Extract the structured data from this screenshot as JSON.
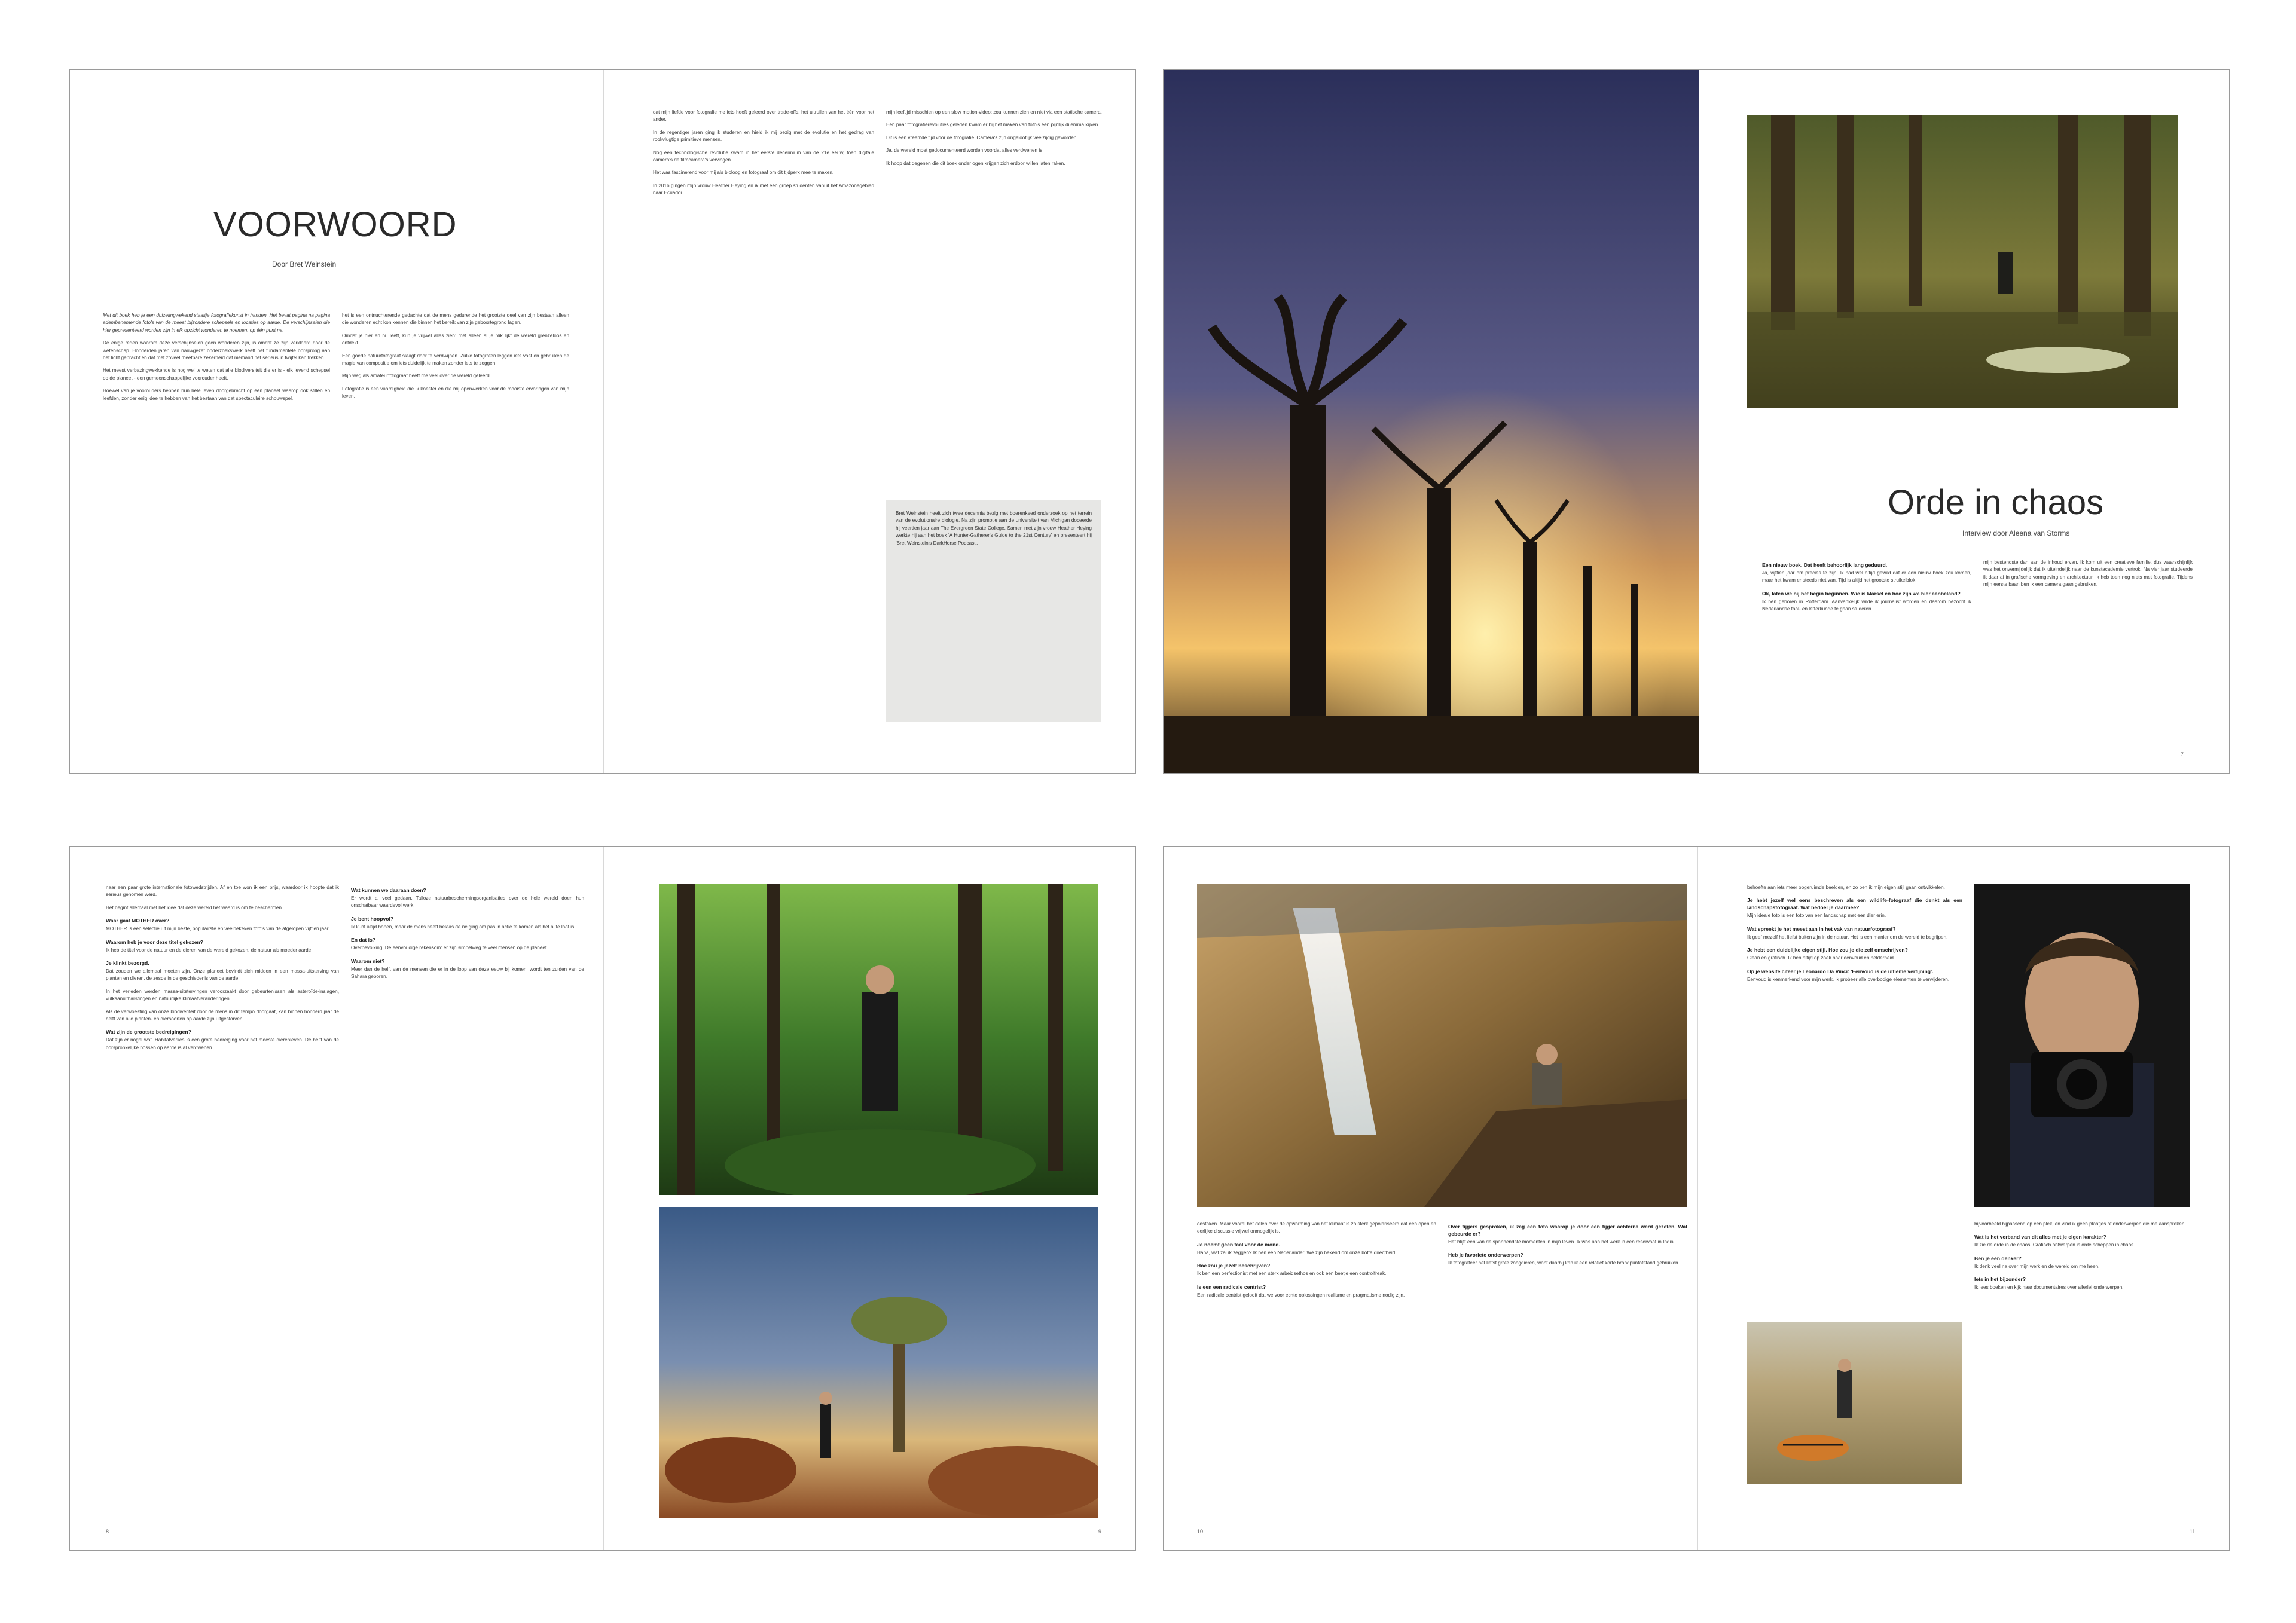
{
  "spread1": {
    "title": "VOORWOORD",
    "byline": "Door Bret Weinstein",
    "lead": "Met dit boek heb je een duizelingwekend staaltje fotografiekunst in handen. Het bevat pagina na pagina adembenemende foto's van de meest bijzondere schepsels en locaties op aarde. De verschijnselen die hier gepresenteerd worden zijn in elk opzicht wonderen te noemen, op één punt na.",
    "col1": [
      "De enige reden waarom deze verschijnselen geen wonderen zijn, is omdat ze zijn verklaard door de wetenschap. Honderden jaren van nauwgezet onderzoekswerk heeft het fundamentele oorsprong aan het licht gebracht en dat met zoveel meetbare zekerheid dat niemand het serieus in twijfel kan trekken.",
      "Het meest verbazingwekkende is nog wel te weten dat alle biodiversiteit die er is - elk levend schepsel op de planeet - een gemeenschappelijke voorouder heeft.",
      "Hoewel van je voorouders hebben hun hele leven doorgebracht op een planeet waarop ook stillen en leefden, zonder enig idee te hebben van het bestaan van dat spectaculaire schouwspel."
    ],
    "col2": [
      "het is een ontnuchterende gedachte dat de mens gedurende het grootste deel van zijn bestaan alleen die wonderen echt kon kennen die binnen het bereik van zijn geboortegrond lagen.",
      "Omdat je hier en nu leeft, kun je vrijwel alles zien: met alleen al je blik lijkt de wereld grenzeloos en ontdekt.",
      "Een goede natuurfotograaf slaagt door te verdwijnen. Zulke fotografen leggen iets vast en gebruiken de magie van compositie om iets duidelijk te maken zonder iets te zeggen.",
      "Mijn weg als amateurfotograaf heeft me veel over de wereld geleerd.",
      "Fotografie is een vaardigheid die ik koester en die mij openwerken voor de mooiste ervaringen van mijn leven."
    ],
    "col3": [
      "dat mijn liefde voor fotografie me iets heeft geleerd over trade-offs, het uitruilen van het één voor het ander.",
      "In de regentiger jaren ging ik studeren en hield ik mij bezig met de evolutie en het gedrag van rookvlugtige primitieve mensen.",
      "Nog een technologische revolutie kwam in het eerste decennium van de 21e eeuw, toen digitale camera's de filmcamera's vervingen.",
      "Het was fascinerend voor mij als bioloog en fotograaf om dit tijdperk mee te maken.",
      "In 2016 gingen mijn vrouw Heather Heying en ik met een groep studenten vanuit het Amazonegebied naar Ecuador."
    ],
    "col4": [
      "mijn leeftijd misschien op een slow motion-video: zou kunnen zien en niet via een statische camera.",
      "Een paar fotografierevoluties geleden kwam er bij het maken van foto's een pijnlijk dilemma kijken.",
      "Dit is een vreemde tijd voor de fotografie. Camera's zijn ongelooflijk veelzijdig geworden.",
      "Ja, de wereld moet gedocumenteerd worden voordat alles verdwenen is.",
      "Ik hoop dat degenen die dit boek onder ogen krijgen zich erdoor willen laten raken."
    ],
    "sidebar": "Bret Weinstein heeft zich twee decennia bezig met boerenkeed onderzoek op het terrein van de evolutionaire biologie. Na zijn promotie aan de universiteit van Michigan doceerde hij veertien jaar aan The Evergreen State College. Samen met zijn vrouw Heather Heying werkte hij aan het boek 'A Hunter-Gatherer's Guide to the 21st Century' en presenteert hij 'Bret Weinstein's DarkHorse Podcast'."
  },
  "spread2": {
    "title": "Orde in chaos",
    "byline": "Interview door Aleena van Storms",
    "q1": "Een nieuw boek. Dat heeft behoorlijk lang geduurd.",
    "a1": "Ja, vijftien jaar om precies te zijn. Ik had wel altijd gewild dat er een nieuw boek zou komen, maar het kwam er steeds niet van. Tijd is altijd het grootste struikelblok.",
    "q2": "Ok, laten we bij het begin beginnen. Wie is Marsel en hoe zijn we hier aanbeland?",
    "a2": "Ik ben geboren in Rotterdam. Aanvankelijk wilde ik journalist worden en daarom bezocht ik Nederlandse taal- en letterkunde te gaan studeren.",
    "col2": "mijn bestendste dan aan de inhoud ervan. Ik kom uit een creatieve familie, dus waarschijnlijk was het onvermijdelijk dat ik uiteindelijk naar de kunstacademie vertrok. Na vier jaar studeerde ik daar af in grafische vormgeving en architectuur. Ik heb toen nog niets met fotografie. Tijdens mijn eerste baan ben ik een camera gaan gebruiken.",
    "folio": "7"
  },
  "spread3": {
    "col1": [
      "naar een paar grote internationale fotowedstrijden. Af en toe won ik een prijs, waardoor ik hoopte dat ik serieus genomen werd.",
      "Het begint allemaal met het idee dat deze wereld het waard is om te beschermen."
    ],
    "q1": "Waar gaat MOTHER over?",
    "a1": "MOTHER is een selectie uit mijn beste, populairste en veelbekeken foto's van de afgelopen vijftien jaar.",
    "q2": "Waarom heb je voor deze titel gekozen?",
    "a2": "Ik heb de titel voor de natuur en de dieren van de wereld gekozen, de natuur als moeder aarde.",
    "q3": "Je klinkt bezorgd.",
    "a3": "Dat zouden we allemaal moeten zijn. Onze planeet bevindt zich midden in een massa-uitsterving van planten en dieren, de zesde in de geschiedenis van de aarde.",
    "a3b": "In het verleden werden massa-uitstervingen veroorzaakt door gebeurtenissen als asteroïde-inslagen, vulkaanuitbarstingen en natuurlijke klimaatveranderingen.",
    "a3c": "Als de verwoesting van onze biodiveriteit door de mens in dit tempo doorgaat, kan binnen honderd jaar de helft van alle planten- en diersoorten op aarde zijn uitgestorven.",
    "q4": "Wat zijn de grootste bedreigingen?",
    "a4": "Dat zijn er nogal wat. Habitatverlies is een grote bedreiging voor het meeste dierenleven. De helft van de oorspronkelijke bossen op aarde is al verdwenen.",
    "col2q1": "Wat kunnen we daaraan doen?",
    "col2a1": "Er wordt al veel gedaan. Talloze natuurbeschermingsorganisaties over de hele wereld doen hun onschatbaar waardevol werk.",
    "col2q2": "Je bent hoopvol?",
    "col2a2": "Ik kunt altijd hopen, maar de mens heeft helaas de neiging om pas in actie te komen als het al te laat is.",
    "col2q3": "En dat is?",
    "col2a3": "Overbevolking. De eenvoudige rekensom: er zijn simpelweg te veel mensen op de planeet.",
    "col2q4": "Waarom niet?",
    "col2a4": "Meer dan de helft van de mensen die er in de loop van deze eeuw bij komen, wordt ten zuiden van de Sahara geboren.",
    "folio_left": "8",
    "folio_right": "9"
  },
  "spread4": {
    "col1": "oostaken. Maar vooral het delen over de opwarming van het klimaat is zo sterk gepolariseerd dat een open en eerlijke discussie vrijwel onmogelijk is.",
    "q1": "Je noemt geen taal voor de mond.",
    "a1": "Haha, wat zal ik zeggen? Ik ben een Nederlander. We zijn bekend om onze botte directheid.",
    "q2": "Hoe zou je jezelf beschrijven?",
    "a2": "Ik ben een perfectionist met een sterk arbeidsethos en ook een beetje een controlfreak.",
    "q3": "Is een een radicale centrist?",
    "a3": "Een radicale centrist gelooft dat we voor echte oplossingen realisme en pragmatisme nodig zijn.",
    "q4": "Over tijgers gesproken, ik zag een foto waarop je door een tijger achterna werd gezeten. Wat gebeurde er?",
    "a4": "Het blijft een van de spannendste momenten in mijn leven. Ik was aan het werk in een reservaat in India.",
    "q5": "Heb je favoriete onderwerpen?",
    "a5": "Ik fotografeer het liefst grote zoogdieren, want daarbij kan ik een relatief korte brandpuntafstand gebruiken.",
    "col3": "behoefte aan iets meer opgeruimde beelden, en zo ben ik mijn eigen stijl gaan ontwikkelen.",
    "q6": "Je hebt jezelf wel eens beschreven als een wildlife-fotograaf die denkt als een landschapsfotograaf. Wat bedoel je daarmee?",
    "a6": "Mijn ideale foto is een foto van een landschap met een dier erin.",
    "q7": "Wat spreekt je het meest aan in het vak van natuurfotograaf?",
    "a7": "Ik geef mezelf het liefst buiten zijn in de natuur. Het is een manier om de wereld te begrijpen.",
    "q8": "Je hebt een duidelijke eigen stijl. Hoe zou je die zelf omschrijven?",
    "a8": "Clean en grafisch. Ik ben altijd op zoek naar eenvoud en helderheid.",
    "q9": "Op je website citeer je Leonardo Da Vinci: 'Eenvoud is de ultieme verfijning'.",
    "a9": "Eenvoud is kenmerkend voor mijn werk. Ik probeer alle overbodige elementen te verwijderen.",
    "col4": "bijvoorbeeld bijpassend op een plek, en vind ik geen plaatjes of onderwerpen die me aanspreken.",
    "q10": "Wat is het verband van dit alles met je eigen karakter?",
    "a10": "Ik zie de orde in de chaos. Grafisch ontwerpen is orde scheppen in chaos.",
    "q11": "Ben je een denker?",
    "a11": "Ik denk veel na over mijn werk en de wereld om me heen.",
    "q12": "Iets in het bijzonder?",
    "a12": "Ik lees boeken en kijk naar documentaires over allerlei onderwerpen.",
    "folio_left": "10",
    "folio_right": "11"
  },
  "colors": {
    "page_bg": "#ffffff",
    "border": "#9a9a9a",
    "sidebar_bg": "#e7e7e5"
  }
}
